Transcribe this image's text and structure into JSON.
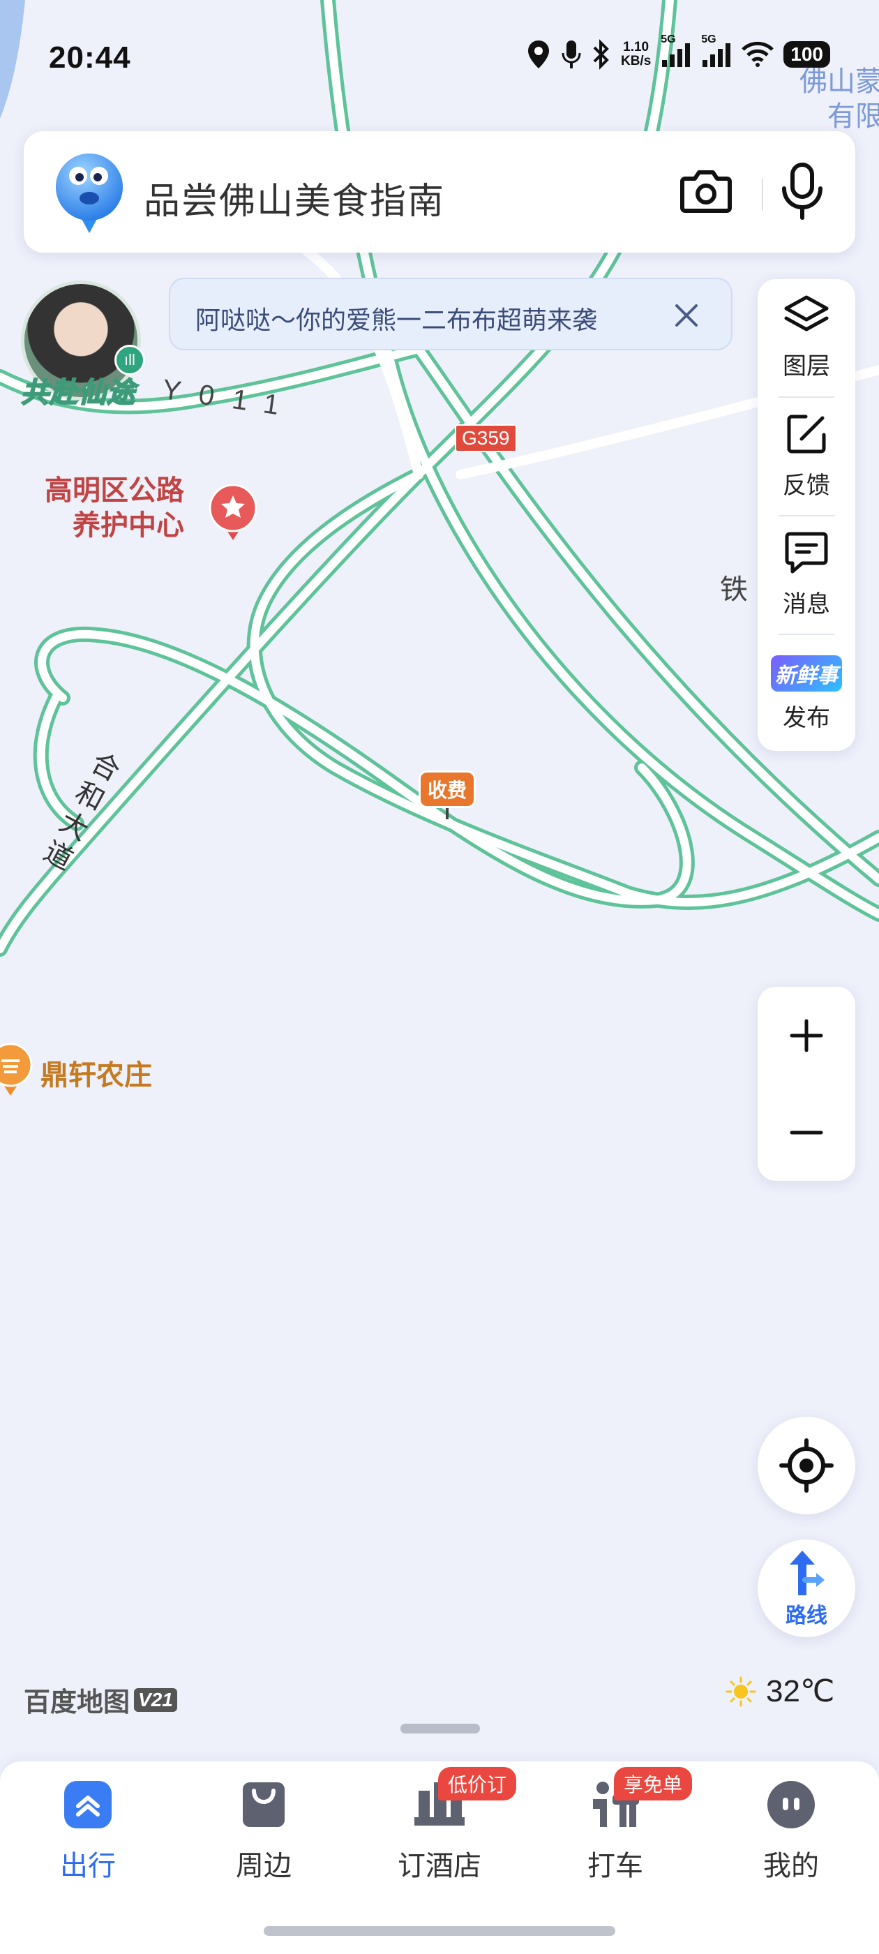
{
  "status_bar": {
    "time": "20:44",
    "net_speed_top": "1.10",
    "net_speed_bottom": "KB/s",
    "signal1_label": "5G",
    "signal2_label": "5G",
    "battery": "100",
    "icons": [
      "location-icon",
      "mic-icon",
      "bluetooth-icon",
      "signal-icon",
      "signal-icon",
      "wifi-icon",
      "battery-icon"
    ]
  },
  "search": {
    "placeholder": "品尝佛山美食指南",
    "icons": [
      "mascot-icon",
      "camera-icon",
      "microphone-icon"
    ]
  },
  "banner": {
    "text": "阿哒哒～你的爱熊一二布布超萌来袭",
    "close_icon": "close-icon"
  },
  "avatar": {
    "label": "共赴仙途"
  },
  "tools": [
    {
      "label": "图层",
      "icon": "layers-icon"
    },
    {
      "label": "反馈",
      "icon": "feedback-edit-icon"
    },
    {
      "label": "消息",
      "icon": "message-icon"
    },
    {
      "label": "发布",
      "icon": "fresh-news-icon",
      "icon_text": "新鲜事"
    }
  ],
  "map": {
    "labels": {
      "top_right_1": "佛山蒙",
      "top_right_2": "有限",
      "gaoming_1": "高明区公路",
      "gaoming_2": "养护中心",
      "road_y011": "Y011",
      "road_hehe": "合和大道",
      "g359": "G359",
      "tie": "铁",
      "toll": "收费",
      "dingxuan": "鼎轩农庄"
    },
    "colors": {
      "background": "#eef0fa",
      "road_green": "#5fc39a",
      "road_fill": "#ffffff",
      "accent": "#2d6cf0"
    }
  },
  "controls": {
    "zoom_in": "+",
    "zoom_out": "−",
    "locate_icon": "locate-icon",
    "route_label": "路线"
  },
  "footer": {
    "brand": "百度地图",
    "brand_version": "V21",
    "temperature": "32℃",
    "weather_icon": "sun-icon"
  },
  "nav": [
    {
      "label": "出行",
      "icon": "travel-icon",
      "active": true
    },
    {
      "label": "周边",
      "icon": "nearby-bag-icon"
    },
    {
      "label": "订酒店",
      "icon": "hotel-icon",
      "badge": "低价订"
    },
    {
      "label": "打车",
      "icon": "taxi-icon",
      "badge": "享免单"
    },
    {
      "label": "我的",
      "icon": "profile-icon"
    }
  ]
}
